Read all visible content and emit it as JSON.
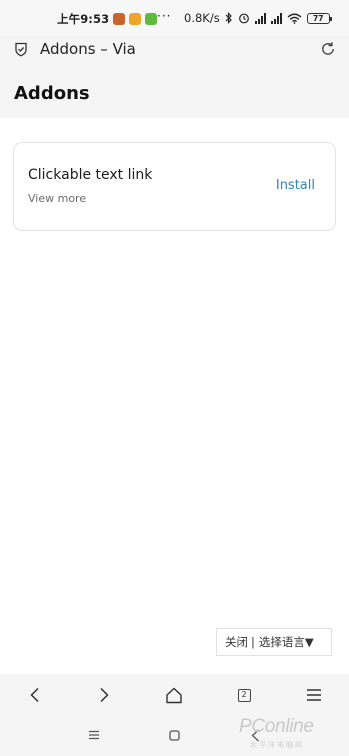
{
  "status_bar": {
    "time": "上午9:53",
    "more": "···",
    "speed": "0.8K/s",
    "battery": "77"
  },
  "header": {
    "window_title": "Addons – Via",
    "page_title": "Addons"
  },
  "addon": {
    "title": "Clickable text link",
    "subtitle": "View more",
    "install_label": "Install"
  },
  "lang_popup": {
    "close_label": "关闭",
    "separator": "|",
    "select_label": "选择语言▼"
  },
  "bottom_nav": {
    "tabs_count": "2"
  },
  "watermark": {
    "brand": "PConline",
    "sub": "太平洋电脑网"
  },
  "colors": {
    "accent": "#2d87b5",
    "header_bg": "#f5f5f5"
  }
}
